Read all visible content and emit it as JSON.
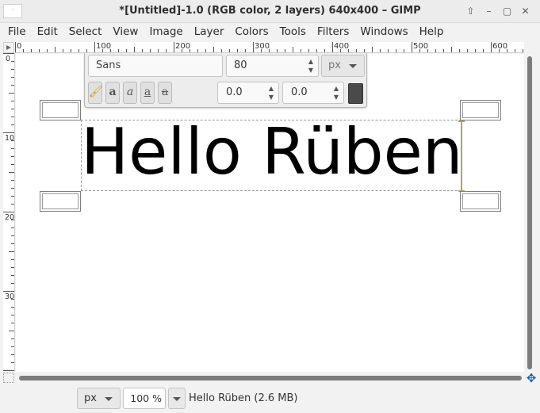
{
  "window": {
    "title": "*[Untitled]-1.0 (RGB color, 2 layers) 640x400 – GIMP",
    "icon": "gimp-image-thumbnail-icon",
    "buttons": [
      "up-icon",
      "minimize-icon",
      "maximize-icon",
      "close-icon"
    ]
  },
  "menu": [
    "File",
    "Edit",
    "Select",
    "View",
    "Image",
    "Layer",
    "Colors",
    "Tools",
    "Filters",
    "Windows",
    "Help"
  ],
  "rulers": {
    "horizontal_labels": [
      "0",
      "100",
      "200",
      "300",
      "400",
      "500",
      "600"
    ],
    "vertical_labels": [
      "0",
      "100",
      "200",
      "300"
    ]
  },
  "text_toolbar": {
    "font": "Sans",
    "size": "80",
    "unit": "px",
    "baseline_offset": "0.0",
    "kerning": "0.0",
    "color": "#4a4a4a",
    "style_buttons": [
      "clear-style-icon",
      "bold-icon",
      "italic-icon",
      "underline-icon",
      "strikethrough-icon"
    ]
  },
  "canvas": {
    "text": "Hello Rüben",
    "background": "#ffffff"
  },
  "statusbar": {
    "unit": "px",
    "zoom": "100 %",
    "message": "Hello Rüben (2.6 MB)"
  }
}
